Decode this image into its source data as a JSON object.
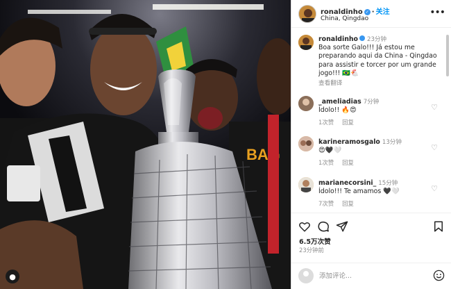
{
  "post": {
    "photo_alt": "Ronaldinho and teammates celebrating with the trophy",
    "user_tag_icon": "person-tag-icon"
  },
  "header": {
    "username": "ronaldinho",
    "dot": "·",
    "follow_label": "关注",
    "location": "China, Qingdao",
    "more_icon": "more-horizontal-icon"
  },
  "caption": {
    "username": "ronaldinho",
    "time": "23分钟",
    "text": "Boa sorte Galo!!! Já estou me preparando aqui da China - Qingdao para assistir e torcer por um grande jogo!!! 🇧🇷🐔",
    "translate": "查看翻译"
  },
  "comments": [
    {
      "username": "_ameliadias",
      "time": "7分钟",
      "text": "Ídolo!! 🔥😍",
      "likes": "1次赞",
      "reply": "回复"
    },
    {
      "username": "karineramosgalo",
      "time": "13分钟",
      "text": "😍🖤🤍",
      "likes": "1次赞",
      "reply": "回复"
    },
    {
      "username": "marianecorsini_",
      "time": "15分钟",
      "text": "Ídolo!!! Te amamos 🖤🤍",
      "likes": "7次赞",
      "reply": "回复"
    }
  ],
  "actions": {
    "likes": "6.5万次赞",
    "posted": "23分钟前"
  },
  "composer": {
    "placeholder": "添加评论..."
  },
  "colors": {
    "link_blue": "#0095f6",
    "secondary_text": "#8e8e8e",
    "border": "#dbdbdb"
  }
}
